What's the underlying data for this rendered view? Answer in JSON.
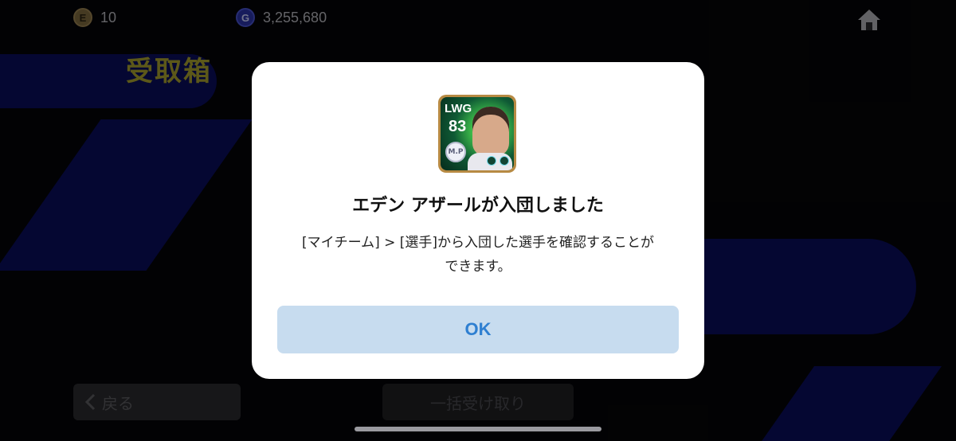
{
  "header": {
    "currencies": [
      {
        "icon": "e-coin-icon",
        "glyph": "E",
        "value": "10"
      },
      {
        "icon": "gp-coin-icon",
        "glyph": "G",
        "value": "3,255,680"
      }
    ]
  },
  "page": {
    "title": "受取箱",
    "back_label": "戻る",
    "bulk_receive_label": "一括受け取り"
  },
  "modal": {
    "card": {
      "position": "LWG",
      "rating": "83",
      "club_badge": "M.P"
    },
    "title": "エデン アザールが入団しました",
    "message_line1": "[マイチーム] > [選手]から入団した選手を確認することが",
    "message_line2": "できます。",
    "ok_label": "OK"
  },
  "colors": {
    "accent": "#a8a02e",
    "ok_bg": "#c7dcef",
    "ok_text": "#2e7fd1"
  }
}
